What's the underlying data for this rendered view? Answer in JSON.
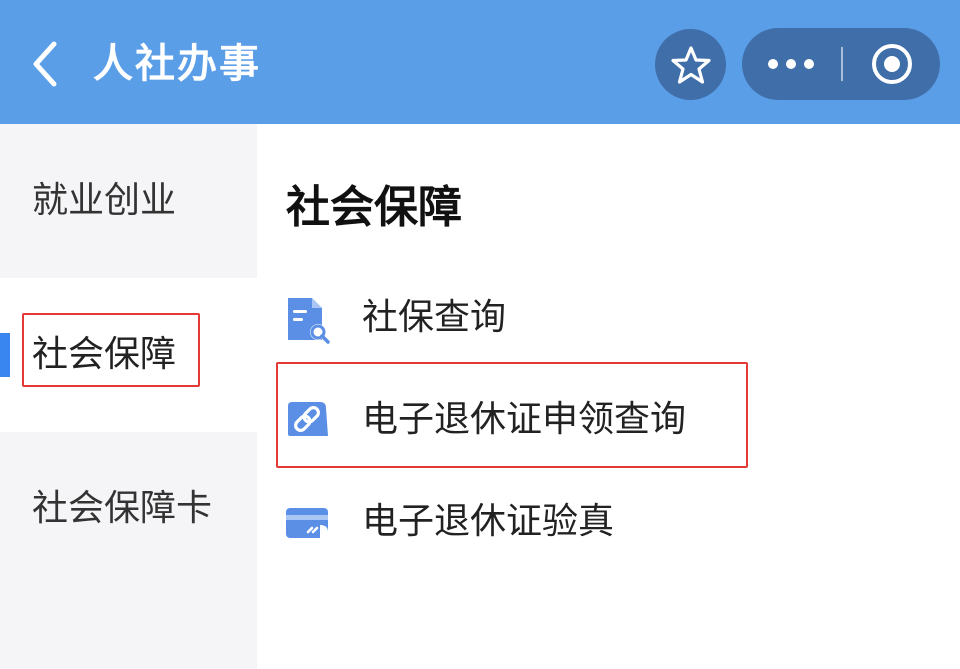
{
  "header": {
    "title": "人社办事",
    "back_icon": "chevron-left-icon",
    "favorite_icon": "star-icon",
    "more_icon": "more-dots-icon",
    "close_icon": "target-close-icon",
    "background_color": "#5b9ee8",
    "button_color": "#3f6ea9"
  },
  "sidebar": {
    "items": [
      {
        "label": "就业创业",
        "active": false
      },
      {
        "label": "社会保障",
        "active": true
      },
      {
        "label": "社会保障卡",
        "active": false
      }
    ],
    "active_color": "#3a86f0"
  },
  "main": {
    "section_title": "社会保障",
    "items": [
      {
        "label": "社保查询",
        "icon": "document-search-icon"
      },
      {
        "label": "电子退休证申领查询",
        "icon": "link-icon"
      },
      {
        "label": "电子退休证验真",
        "icon": "card-icon"
      }
    ]
  },
  "highlight_color": "#e53935"
}
